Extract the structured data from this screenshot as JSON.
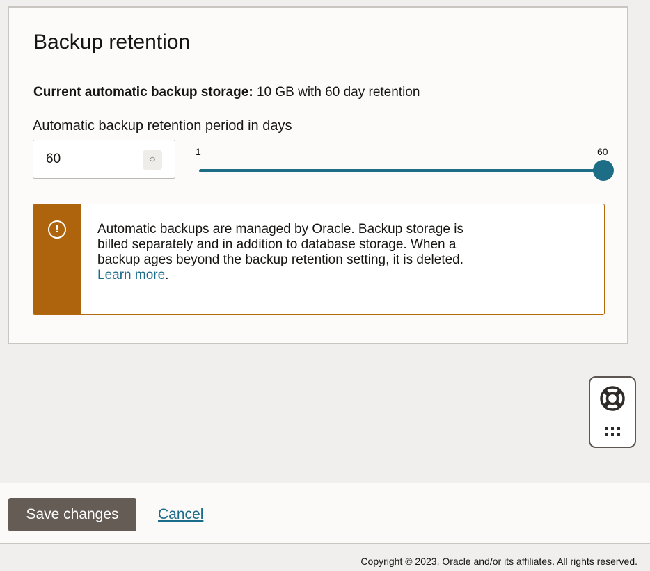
{
  "panel": {
    "title": "Backup retention",
    "storage_label": "Current automatic backup storage:",
    "storage_value": "10 GB with 60 day retention",
    "period_label": "Automatic backup retention period in days",
    "period_value": "60",
    "slider": {
      "min_label": "1",
      "max_label": "60",
      "value": 60,
      "min": 1,
      "max": 60
    },
    "alert": {
      "line1": "Automatic backups are managed by Oracle. Backup storage is",
      "line2": "billed separately and in addition to database storage. When a",
      "line3": "backup ages beyond the backup retention setting, it is deleted.",
      "link": "Learn more",
      "link_suffix": "."
    }
  },
  "footer": {
    "save_label": "Save changes",
    "cancel_label": "Cancel",
    "copyright": "Copyright © 2023, Oracle and/or its affiliates. All rights reserved."
  },
  "icons": {
    "warning": "exclamation-circle-icon",
    "help": "lifebuoy-icon",
    "grid": "apps-grid-icon",
    "stepper": "up-down-chevron-icon"
  },
  "colors": {
    "accent": "#1d6d87",
    "warning": "#ad640d",
    "button": "#645c55",
    "link": "#1b6b8b"
  }
}
